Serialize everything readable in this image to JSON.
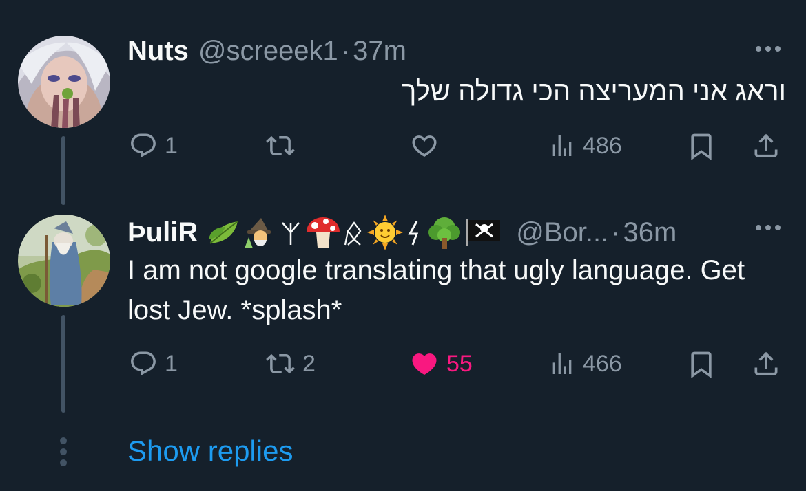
{
  "tweets": [
    {
      "name": "Nuts",
      "handle": "@screeek1",
      "separator": "·",
      "time": "37m",
      "text": "וראג אני המעריצה הכי גדולה שלך",
      "replies": "1",
      "retweets": "",
      "likes": "",
      "views": "486"
    },
    {
      "name": "ÞuliR",
      "name_emojis": [
        "leaves-emoji",
        "mage-emoji",
        "rune-algiz",
        "mushroom-emoji",
        "rune-othala",
        "sun-face-emoji",
        "lightning-rune",
        "tree-emoji",
        "pirate-flag-emoji"
      ],
      "handle": "@Bor...",
      "separator": "·",
      "time": "36m",
      "text": "I am not google translating that ugly language. Get lost Jew. *splash*",
      "replies": "1",
      "retweets": "2",
      "likes": "55",
      "views": "466"
    }
  ],
  "show_replies": "Show replies",
  "colors": {
    "background": "#15202b",
    "text": "#f7f9f9",
    "muted": "#8b98a5",
    "link": "#1d9bf0",
    "like": "#f91880",
    "thread": "#425364"
  }
}
